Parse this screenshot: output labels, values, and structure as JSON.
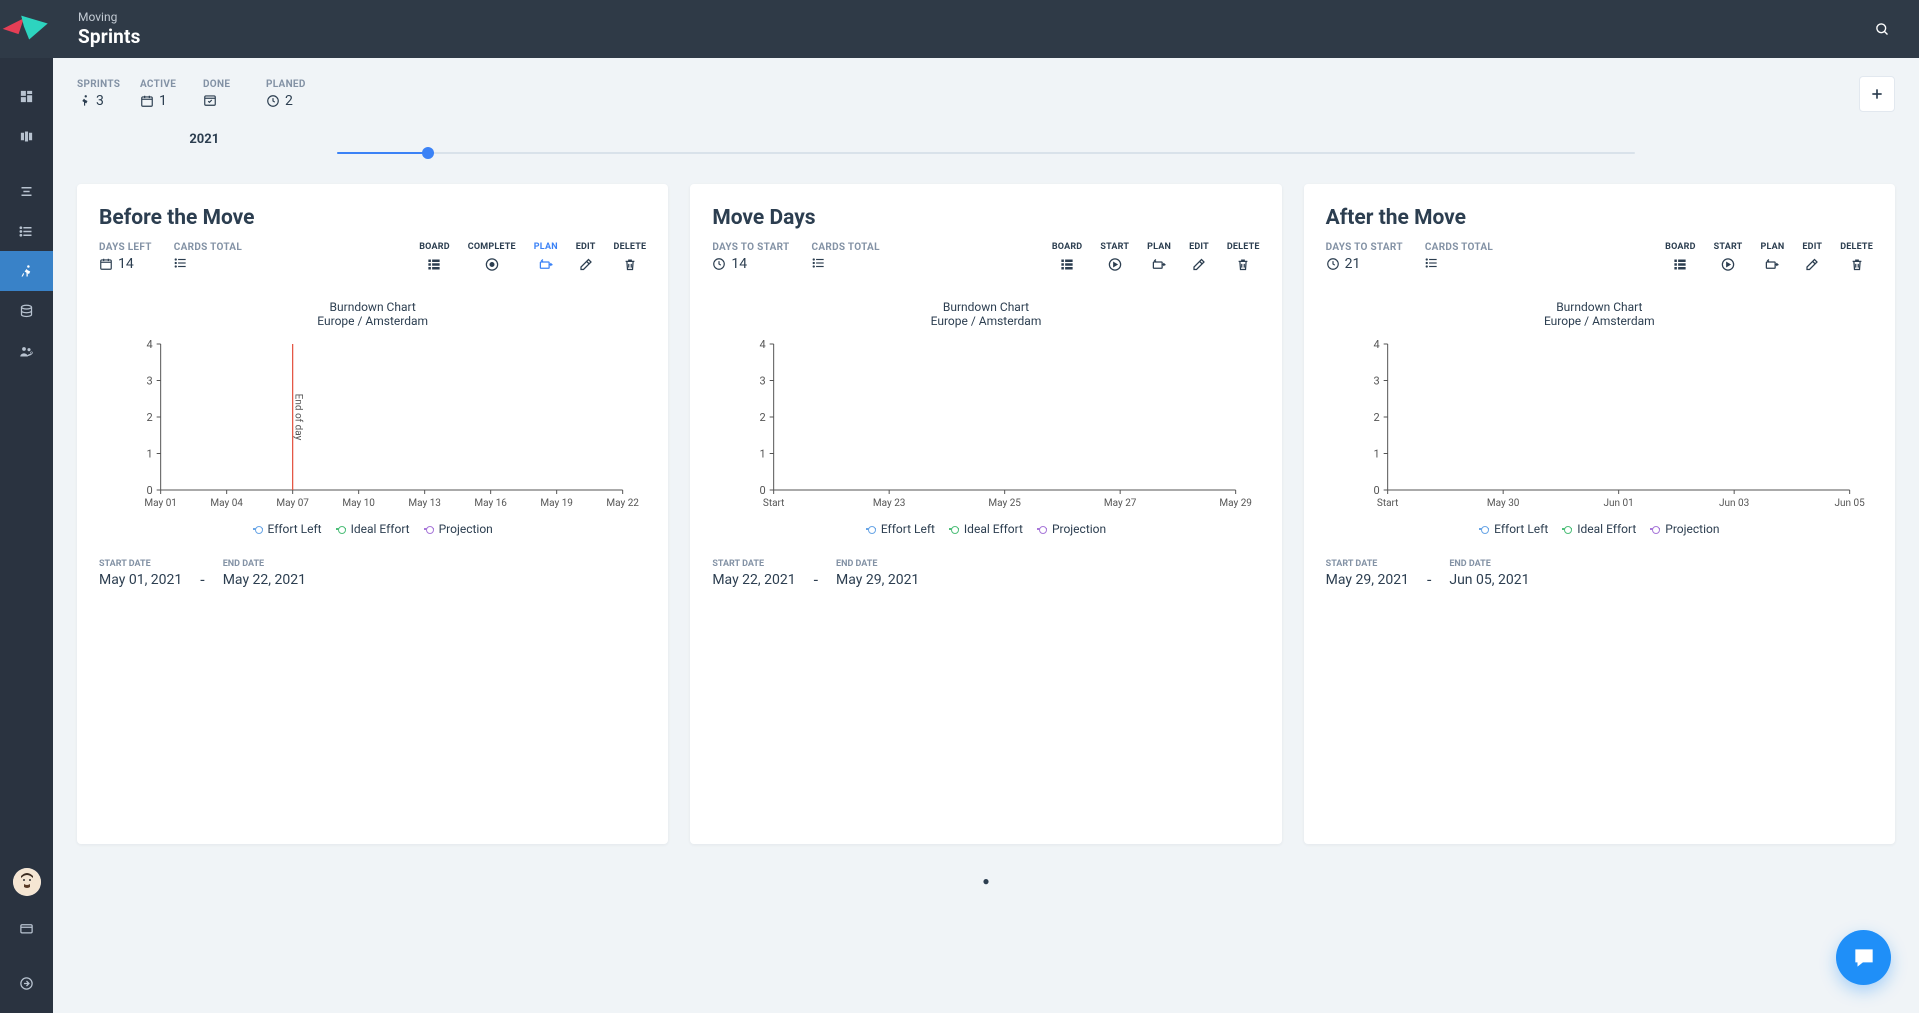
{
  "header": {
    "parent": "Moving",
    "title": "Sprints"
  },
  "summary": {
    "labels": {
      "sprints": "SPRINTS",
      "active": "ACTIVE",
      "done": "DONE",
      "planned": "PLANED"
    },
    "sprints": "3",
    "active": "1",
    "done": "",
    "planned": "2"
  },
  "timeline": {
    "year": "2021",
    "progress_percent": 7
  },
  "action_labels": {
    "board": "BOARD",
    "complete": "COMPLETE",
    "start": "START",
    "plan": "PLAN",
    "edit": "EDIT",
    "delete": "DELETE"
  },
  "stat_labels": {
    "days_left": "DAYS LEFT",
    "days_to_start": "DAYS TO START",
    "cards_total": "CARDS TOTAL",
    "start_date": "START DATE",
    "end_date": "END DATE"
  },
  "legend": {
    "effort_left": "Effort Left",
    "ideal_effort": "Ideal Effort",
    "projection": "Projection"
  },
  "cards": [
    {
      "title": "Before the Move",
      "days_label_key": "days_left",
      "days": "14",
      "cards_total": "",
      "actions": [
        "board",
        "complete",
        "plan",
        "edit",
        "delete"
      ],
      "accent_action": "plan",
      "chart_title": "Burndown Chart",
      "chart_sub": "Europe / Amsterdam",
      "start_date": "May 01, 2021",
      "end_date": "May 22, 2021"
    },
    {
      "title": "Move Days",
      "days_label_key": "days_to_start",
      "days": "14",
      "cards_total": "",
      "actions": [
        "board",
        "start",
        "plan",
        "edit",
        "delete"
      ],
      "accent_action": null,
      "chart_title": "Burndown Chart",
      "chart_sub": "Europe / Amsterdam",
      "start_date": "May 22, 2021",
      "end_date": "May 29, 2021"
    },
    {
      "title": "After the Move",
      "days_label_key": "days_to_start",
      "days": "21",
      "cards_total": "",
      "actions": [
        "board",
        "start",
        "plan",
        "edit",
        "delete"
      ],
      "accent_action": null,
      "chart_title": "Burndown Chart",
      "chart_sub": "Europe / Amsterdam",
      "start_date": "May 29, 2021",
      "end_date": "Jun 05, 2021"
    }
  ],
  "chart_data": [
    {
      "type": "line",
      "title": "Burndown Chart",
      "subtitle": "Europe / Amsterdam",
      "ylim": [
        0,
        4
      ],
      "y_ticks": [
        0,
        1,
        2,
        3,
        4
      ],
      "x_ticks": [
        "May 01",
        "May 04",
        "May 07",
        "May 10",
        "May 13",
        "May 16",
        "May 19",
        "May 22"
      ],
      "annotations": [
        {
          "x": "May 07",
          "text": "End of day",
          "color": "#e34d3a"
        }
      ],
      "series": [
        {
          "name": "Effort Left",
          "values": []
        },
        {
          "name": "Ideal Effort",
          "values": []
        },
        {
          "name": "Projection",
          "values": []
        }
      ]
    },
    {
      "type": "line",
      "title": "Burndown Chart",
      "subtitle": "Europe / Amsterdam",
      "ylim": [
        0,
        4
      ],
      "y_ticks": [
        0,
        1,
        2,
        3,
        4
      ],
      "x_ticks": [
        "Start",
        "May 23",
        "May 25",
        "May 27",
        "May 29"
      ],
      "series": [
        {
          "name": "Effort Left",
          "values": []
        },
        {
          "name": "Ideal Effort",
          "values": []
        },
        {
          "name": "Projection",
          "values": []
        }
      ]
    },
    {
      "type": "line",
      "title": "Burndown Chart",
      "subtitle": "Europe / Amsterdam",
      "ylim": [
        0,
        4
      ],
      "y_ticks": [
        0,
        1,
        2,
        3,
        4
      ],
      "x_ticks": [
        "Start",
        "May 30",
        "Jun 01",
        "Jun 03",
        "Jun 05"
      ],
      "series": [
        {
          "name": "Effort Left",
          "values": []
        },
        {
          "name": "Ideal Effort",
          "values": []
        },
        {
          "name": "Projection",
          "values": []
        }
      ]
    }
  ]
}
